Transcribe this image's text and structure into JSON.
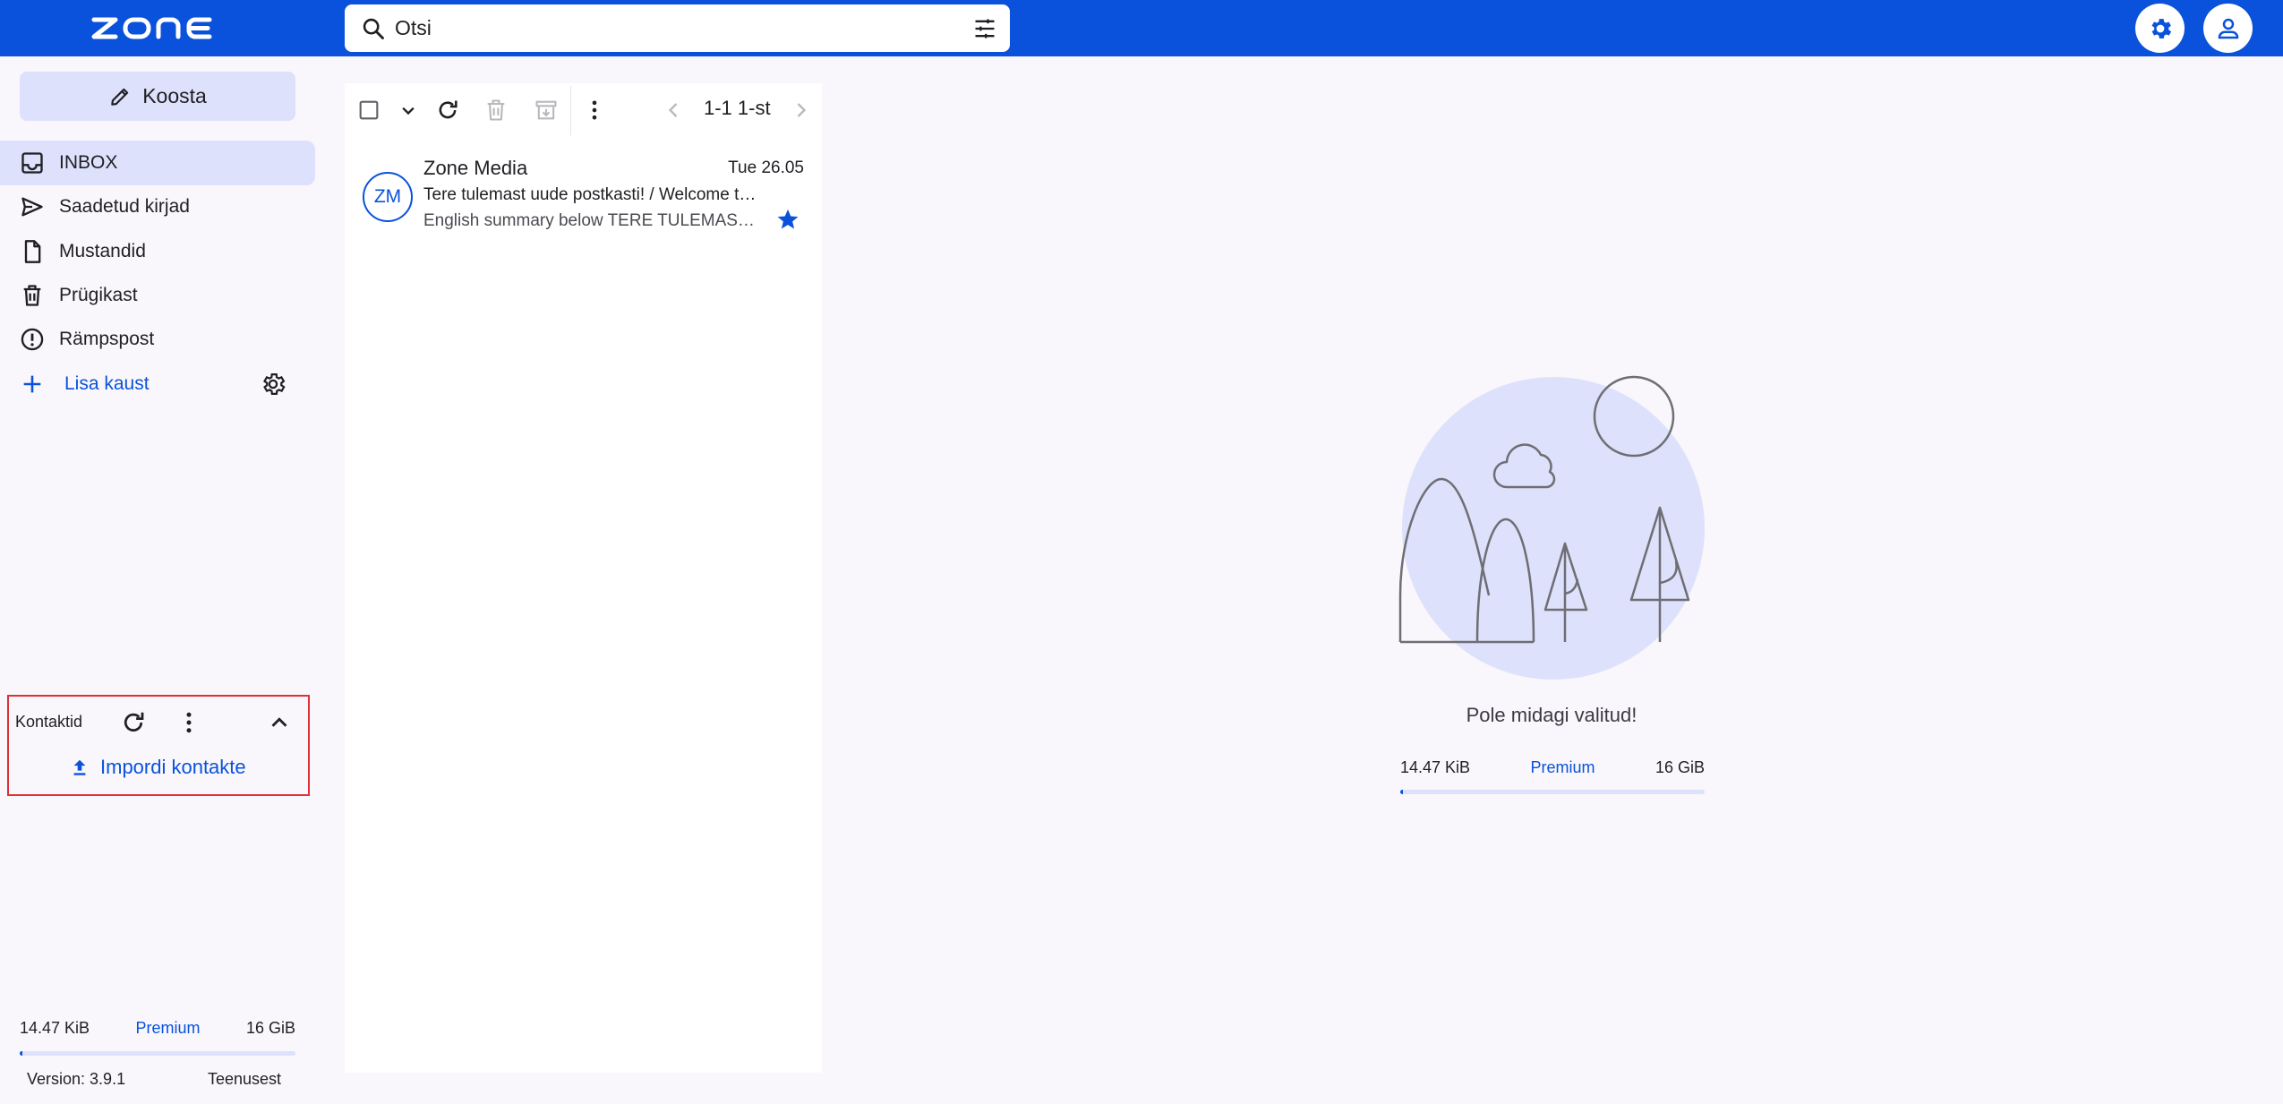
{
  "header": {
    "logo_text": "ZONE",
    "search_placeholder": "Otsi"
  },
  "sidebar": {
    "compose_label": "Koosta",
    "items": [
      {
        "label": "INBOX",
        "icon": "inbox-icon",
        "active": true
      },
      {
        "label": "Saadetud kirjad",
        "icon": "send-icon"
      },
      {
        "label": "Mustandid",
        "icon": "draft-icon"
      },
      {
        "label": "Prügikast",
        "icon": "trash-icon"
      },
      {
        "label": "Rämpspost",
        "icon": "spam-icon"
      }
    ],
    "add_folder_label": "Lisa kaust",
    "contacts": {
      "title": "Kontaktid",
      "import_label": "Impordi kontakte"
    },
    "quota": {
      "used": "14.47 KiB",
      "plan": "Premium",
      "total": "16 GiB",
      "used_fraction": 0.01
    },
    "version": "Version: 3.9.1",
    "terms": "Teenusest"
  },
  "list": {
    "pager": "1-1 1-st",
    "messages": [
      {
        "avatar": "ZM",
        "sender": "Zone Media",
        "date": "Tue 26.05",
        "subject": "Tere tulemast uude postkasti! / Welcome to your new mailbox!",
        "snippet": "English summary below TERE TULEMAST UUDE POSTKASTI",
        "starred": true
      }
    ]
  },
  "preview": {
    "empty_text": "Pole midagi valitud!",
    "quota": {
      "used": "14.47 KiB",
      "plan": "Premium",
      "total": "16 GiB",
      "used_fraction": 0.01
    }
  },
  "colors": {
    "brand": "#0a52db",
    "active_bg": "#dde1fb",
    "highlight_border": "#e0313a"
  }
}
